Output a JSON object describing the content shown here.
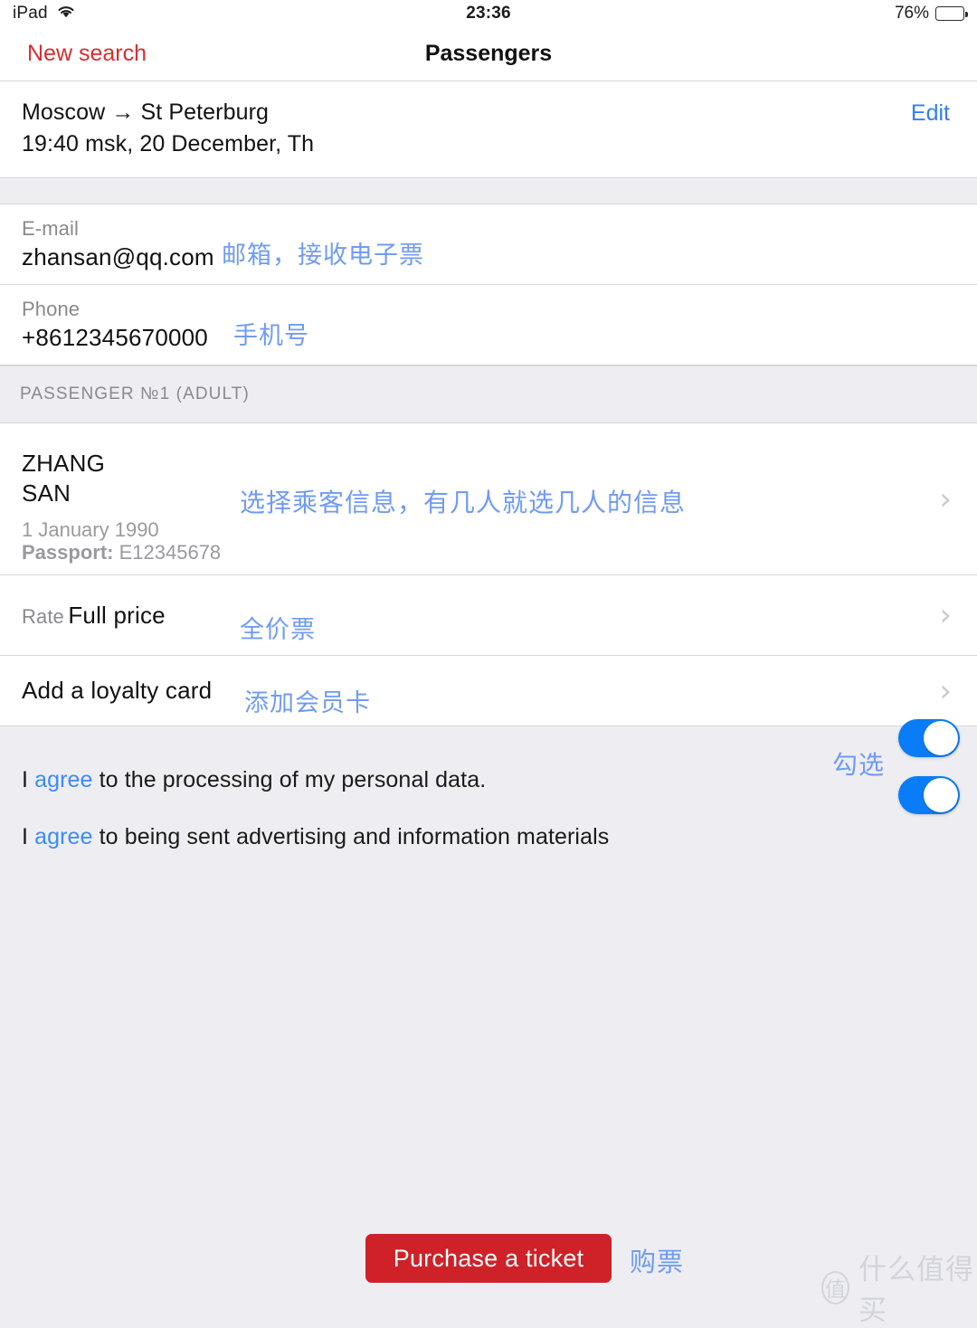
{
  "status_bar": {
    "device": "iPad",
    "wifi_icon": "wifi-icon",
    "time": "23:36",
    "battery_percent": "76%",
    "battery_level": 76,
    "battery_icon": "battery-icon"
  },
  "nav_bar": {
    "back_label": "New search",
    "title": "Passengers",
    "back_color": "#d62e31"
  },
  "route": {
    "line1": "Moscow → St Peterburg",
    "line2": "19:40 msk, 20 December, Th",
    "edit_label": "Edit",
    "edit_color": "#2f7ff6"
  },
  "contact": {
    "email": {
      "label": "E-mail",
      "value": "zhansan@qq.com",
      "annotation": "邮箱，接收电子票"
    },
    "phone": {
      "label": "Phone",
      "value": "+8612345670000",
      "annotation": "手机号"
    }
  },
  "passenger_section": {
    "header": "PASSENGER №1 (ADULT)",
    "name_line1": "ZHANG",
    "name_line2": "SAN",
    "birthdate": "1 January 1990",
    "passport_label": "Passport:",
    "passport_value": " E12345678",
    "annotation": "选择乘客信息，有几人就选几人的信息",
    "chevron_icon": "chevron-right-icon"
  },
  "rate": {
    "label": "Rate",
    "value": "Full price",
    "annotation": "全价票",
    "chevron_icon": "chevron-right-icon"
  },
  "loyalty": {
    "label": "Add a loyalty card",
    "annotation": "添加会员卡",
    "chevron_icon": "chevron-right-icon"
  },
  "agreements": {
    "annotation": "勾选",
    "toggle_color": "#0b7cf7",
    "items": [
      {
        "prefix": "I ",
        "link": "agree",
        "suffix": " to the processing of my personal data.",
        "toggle_on": true
      },
      {
        "prefix": "I ",
        "link": "agree",
        "suffix": " to being sent advertising and information materials",
        "toggle_on": true
      }
    ]
  },
  "footer": {
    "purchase_label": "Purchase a ticket",
    "purchase_annotation": "购票",
    "purchase_color": "#cf2128"
  },
  "watermark": {
    "badge": "值",
    "text": "什么值得买"
  }
}
